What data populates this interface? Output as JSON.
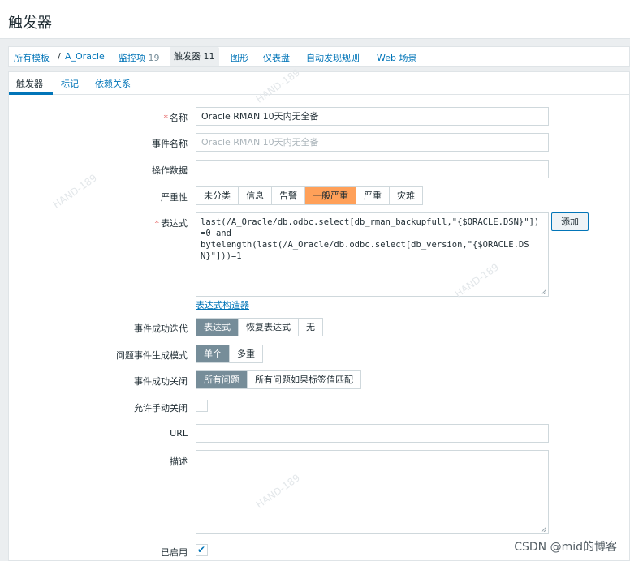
{
  "page": {
    "title": "触发器"
  },
  "breadcrumb": {
    "all_templates": "所有模板",
    "separator": "/",
    "host": "A_Oracle",
    "items_label": "监控项",
    "items_count": "19",
    "triggers_label": "触发器",
    "triggers_count": "11",
    "graphs": "图形",
    "dashboards": "仪表盘",
    "discovery": "自动发现规则",
    "web": "Web 场景"
  },
  "tabs": [
    {
      "label": "触发器",
      "active": true
    },
    {
      "label": "标记",
      "active": false
    },
    {
      "label": "依赖关系",
      "active": false
    }
  ],
  "form": {
    "name": {
      "required": "*",
      "label": "名称",
      "value": "Oracle RMAN 10天内无全备"
    },
    "event_name": {
      "label": "事件名称",
      "placeholder": "Oracle RMAN 10天内无全备"
    },
    "op_data": {
      "label": "操作数据",
      "value": ""
    },
    "severity": {
      "label": "严重性",
      "options": [
        "未分类",
        "信息",
        "告警",
        "一般严重",
        "严重",
        "灾难"
      ],
      "selected": "一般严重"
    },
    "expression": {
      "required": "*",
      "label": "表达式",
      "value": "last(/A_Oracle/db.odbc.select[db_rman_backupfull,\"{$ORACLE.DSN}\"])=0 and\nbytelength(last(/A_Oracle/db.odbc.select[db_version,\"{$ORACLE.DSN}\"]))=1",
      "add_button": "添加",
      "constructor_link": "表达式构造器"
    },
    "ok_event": {
      "label": "事件成功迭代",
      "options": [
        "表达式",
        "恢复表达式",
        "无"
      ],
      "selected": "表达式"
    },
    "problem_mode": {
      "label": "问题事件生成模式",
      "options": [
        "单个",
        "多重"
      ],
      "selected": "单个"
    },
    "ok_close": {
      "label": "事件成功关闭",
      "options": [
        "所有问题",
        "所有问题如果标签值匹配"
      ],
      "selected": "所有问题"
    },
    "manual_close": {
      "label": "允许手动关闭",
      "checked": false
    },
    "url": {
      "label": "URL",
      "value": ""
    },
    "description": {
      "label": "描述",
      "value": ""
    },
    "enabled": {
      "label": "已启用",
      "checked": true,
      "check_glyph": "✔"
    }
  },
  "watermarks": [
    "HAND-189",
    "HAND-189",
    "HAND-189",
    "HAND-189"
  ],
  "footer": {
    "csdn": "CSDN @mid的博客"
  },
  "colors": {
    "accent": "#0275b8",
    "selected_segment": "#768d99",
    "severity_average": "#ffa059",
    "required": "#e45959"
  }
}
